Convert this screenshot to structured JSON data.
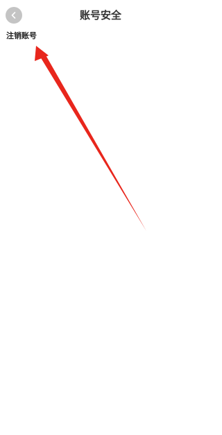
{
  "header": {
    "title": "账号安全",
    "back_icon": "chevron-left-icon"
  },
  "menu": {
    "items": [
      {
        "label": "注销账号"
      }
    ]
  },
  "annotation": {
    "type": "arrow",
    "color": "#e8261c"
  }
}
